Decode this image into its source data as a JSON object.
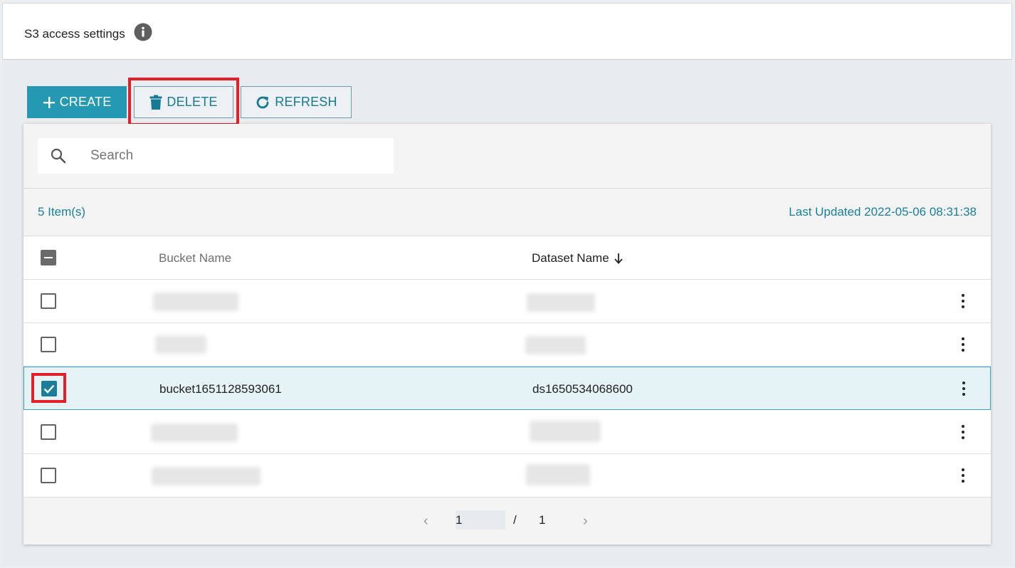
{
  "header": {
    "title": "S3 access settings",
    "info_icon": "info-icon"
  },
  "toolbar": {
    "create_label": "CREATE",
    "delete_label": "DELETE",
    "refresh_label": "REFRESH",
    "accent_color": "#2599b4",
    "highlight_color": "#e2202a"
  },
  "search": {
    "placeholder": "Search",
    "value": ""
  },
  "summary": {
    "items_count": "5 Item(s)",
    "last_updated": "Last Updated 2022-05-06 08:31:38"
  },
  "table": {
    "select_all_state": "indeterminate",
    "columns": {
      "bucket": "Bucket Name",
      "dataset": "Dataset Name"
    },
    "sort_indicator": "arrow-down-icon",
    "rows": [
      {
        "bucket": "",
        "dataset": "",
        "checked": false,
        "redacted": true
      },
      {
        "bucket": "",
        "dataset": "",
        "checked": false,
        "redacted": true
      },
      {
        "bucket": "bucket1651128593061",
        "dataset": "ds1650534068600",
        "checked": true,
        "redacted": false
      },
      {
        "bucket": "",
        "dataset": "",
        "checked": false,
        "redacted": true
      },
      {
        "bucket": "",
        "dataset": "",
        "checked": false,
        "redacted": true
      }
    ]
  },
  "pagination": {
    "current": "1",
    "separator": "/",
    "total": "1"
  }
}
